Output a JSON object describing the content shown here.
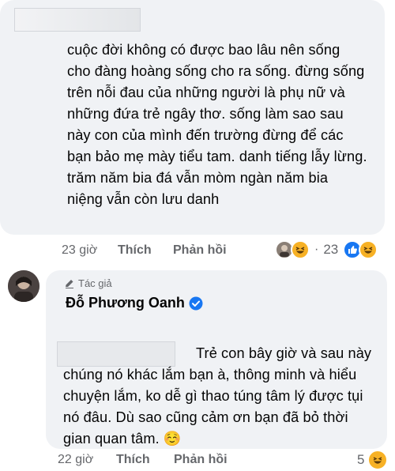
{
  "comment1": {
    "text": "cuộc đời không có được bao lâu nên sống cho đàng hoàng sống cho ra sống. đừng sống trên nỗi đau của những người là phụ nữ và những đứa trẻ ngây thơ. sống làm sao sau này con của mình đến trường đừng để các bạn bảo mẹ mày tiểu tam. danh tiếng lẫy lừng. trăm năm bia đá vẫn mòm ngàn năm bia niệng vẫn còn lưu danh",
    "time": "23 giờ",
    "like_label": "Thích",
    "reply_label": "Phản hồi",
    "reaction_count": "23",
    "separator": "·"
  },
  "comment2": {
    "author_badge": "Tác giả",
    "author_name": "Đỗ Phương Oanh",
    "text": "Trẻ con bây giờ và sau này chúng nó khác lắm bạn à, thông minh và hiểu chuyện lắm, ko dễ gì thao túng tâm lý được tụi nó đâu. Dù sao cũng cảm ơn bạn đã bỏ thời gian quan tâm. ☺️",
    "time": "22 giờ",
    "like_label": "Thích",
    "reply_label": "Phản hồi",
    "reaction_count": "5"
  },
  "colors": {
    "bubble": "#f0f2f5",
    "meta_text": "#65676b",
    "verified": "#1877f2",
    "haha": "#f7b125"
  }
}
